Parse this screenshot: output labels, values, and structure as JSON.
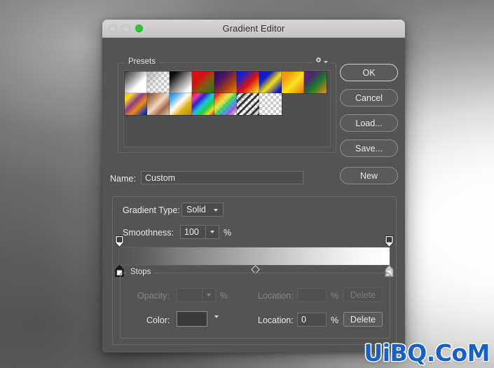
{
  "window": {
    "title": "Gradient Editor",
    "traffic_lights": [
      "close",
      "minimize",
      "zoom"
    ]
  },
  "presets": {
    "legend": "Presets",
    "gear_icon": "gear-icon",
    "swatches": [
      {
        "name": "foreground-to-transparent",
        "style": "linear-gradient(135deg,#3a3a3a 0%,#8d8d8d 30%,#ffffff 62%,#ffffff 100%)",
        "checker": false
      },
      {
        "name": "transparent-stripes",
        "style": "linear-gradient(135deg,rgba(160,160,160,0.75) 0%,rgba(200,200,200,0.35) 45%,rgba(255,255,255,0) 95%)",
        "checker": true
      },
      {
        "name": "black-to-white",
        "style": "linear-gradient(135deg,#000000 0%,#111111 18%,#9a9a9a 55%,#ffffff 85%)",
        "checker": false
      },
      {
        "name": "red-to-green",
        "style": "linear-gradient(135deg,#e01010 0%,#cf1212 35%,#8a5a10 58%,#1d7a1d 100%)",
        "checker": false
      },
      {
        "name": "violet-orange",
        "style": "linear-gradient(135deg,#2a1060 0%,#4a1468 32%,#a03a12 62%,#f58a10 100%)",
        "checker": false
      },
      {
        "name": "blue-red-yellow",
        "style": "linear-gradient(135deg,#0a18cf 0%,#2020c8 22%,#e01010 55%,#f0d020 92%)",
        "checker": false
      },
      {
        "name": "blue-yellow-blue",
        "style": "linear-gradient(135deg,#0a18cf 0%,#1020c8 28%,#f5e010 55%,#0a18cf 88%)",
        "checker": false
      },
      {
        "name": "orange-yellow-orange",
        "style": "linear-gradient(135deg,#f58a10 0%,#f59a10 22%,#f8e420 55%,#f07810 95%)",
        "checker": false
      },
      {
        "name": "violet-green-orange",
        "style": "linear-gradient(135deg,#6a2080 0%,#4a2a70 28%,#1d7a2a 58%,#f08a10 100%)",
        "checker": false
      },
      {
        "name": "yellow-violet-orange-blue",
        "style": "linear-gradient(135deg,#f5c010 0%,#f8d820 18%,#8a3a90 42%,#f08a10 62%,#0a2fb0 92%)",
        "checker": false
      },
      {
        "name": "copper",
        "style": "linear-gradient(135deg,#6a4a34 0%,#b98a62 25%,#f2d8c2 48%,#a06a46 72%,#e8cbb4 100%)",
        "checker": false
      },
      {
        "name": "blue-yellow-blue-2",
        "style": "linear-gradient(135deg,#1888e0 0%,#58b0ee 20%,#ffffff 44%,#e0b010 68%,#b88a10 100%)",
        "checker": false
      },
      {
        "name": "spectrum",
        "style": "linear-gradient(135deg,#e01010 0%,#f040a0 16%,#3020d0 32%,#20c0e0 50%,#20d040 68%,#f0e020 84%,#e01010 100%)",
        "checker": false
      },
      {
        "name": "transparent-rainbow",
        "style": "linear-gradient(135deg,rgba(224,16,16,0.9) 8%,rgba(240,160,16,0.85) 24%,rgba(240,230,32,0.8) 38%,rgba(32,200,64,0.8) 52%,rgba(32,140,224,0.8) 66%,rgba(160,48,200,0.8) 80%,rgba(255,255,255,0) 96%)",
        "checker": true
      },
      {
        "name": "transparent-stripes-2",
        "style": "repeating-linear-gradient(135deg,rgba(40,40,40,0.92) 0 3px,rgba(255,255,255,0) 3px 7px)",
        "checker": true
      },
      {
        "name": "transparent-checker",
        "style": "linear-gradient(135deg,rgba(255,255,255,0.02) 0%,rgba(255,255,255,0.02) 100%)",
        "checker": true
      }
    ]
  },
  "buttons": {
    "ok": "OK",
    "cancel": "Cancel",
    "load": "Load...",
    "save": "Save...",
    "new": "New"
  },
  "name_row": {
    "label": "Name:",
    "value": "Custom",
    "placeholder": "Custom"
  },
  "gradient": {
    "type_label": "Gradient Type:",
    "type_value": "Solid",
    "smoothness_label": "Smoothness:",
    "smoothness_value": "100",
    "percent": "%",
    "strip_start_color": "#000000",
    "strip_end_color": "#ffffff",
    "opacity_stops": [
      {
        "name": "opacity-stop-left",
        "position_pct": 0,
        "fill": "#3c3c3c"
      },
      {
        "name": "opacity-stop-right",
        "position_pct": 100,
        "fill": "#3c3c3c"
      }
    ],
    "color_stops": [
      {
        "name": "color-stop-left",
        "position_pct": 0,
        "fill": "#ffffff"
      },
      {
        "name": "color-stop-right",
        "position_pct": 100,
        "fill": "#ffffff"
      }
    ],
    "midpoint_pct": 50
  },
  "stops": {
    "legend": "Stops",
    "opacity_label": "Opacity:",
    "opacity_value": "",
    "opacity_percent": "%",
    "opacity_location_label": "Location:",
    "opacity_location_value": "",
    "opacity_location_percent": "%",
    "opacity_delete": "Delete",
    "color_label": "Color:",
    "color_swatch": "#3a3a3a",
    "color_location_label": "Location:",
    "color_location_value": "0",
    "color_location_percent": "%",
    "color_delete": "Delete"
  },
  "watermark": {
    "text": "UiBQ.CoM",
    "color": "#1561c9"
  }
}
